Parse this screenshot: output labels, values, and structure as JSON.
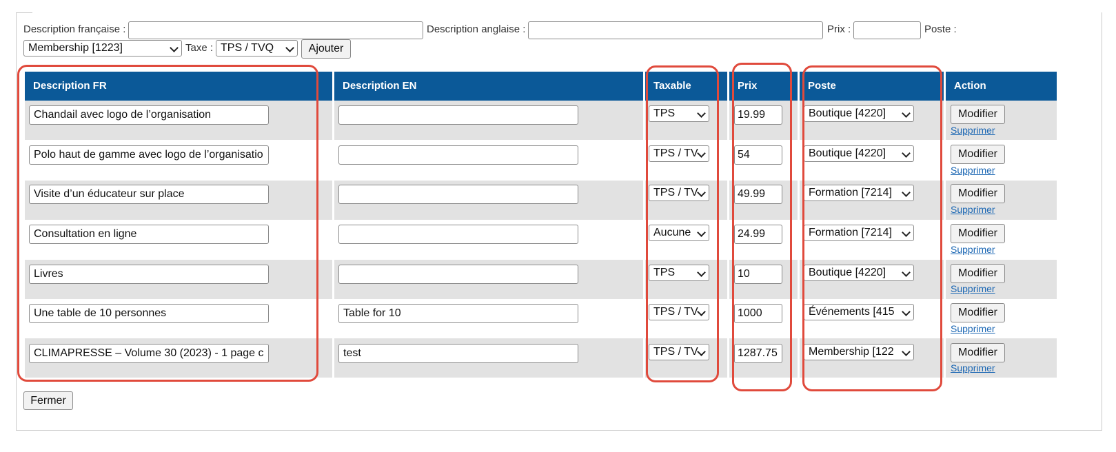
{
  "form": {
    "desc_fr_label": "Description française :",
    "desc_en_label": "Description anglaise :",
    "prix_label": "Prix :",
    "poste_label": "Poste :",
    "poste_selected": "Membership [1223]",
    "taxe_label": "Taxe :",
    "taxe_selected": "TPS / TVQ",
    "add_label": "Ajouter"
  },
  "table": {
    "headers": {
      "desc_fr": "Description FR",
      "desc_en": "Description EN",
      "taxable": "Taxable",
      "prix": "Prix",
      "poste": "Poste",
      "action": "Action"
    },
    "rows": [
      {
        "desc_fr": "Chandail avec logo de l’organisation",
        "desc_en": "",
        "taxable": "TPS",
        "prix": "19.99",
        "poste": "Boutique [4220]",
        "modify": "Modifier",
        "delete": "Supprimer"
      },
      {
        "desc_fr": "Polo haut de gamme avec logo de l’organisatio",
        "desc_en": "",
        "taxable": "TPS / TV",
        "prix": "54",
        "poste": "Boutique [4220]",
        "modify": "Modifier",
        "delete": "Supprimer"
      },
      {
        "desc_fr": "Visite d’un éducateur sur place",
        "desc_en": "",
        "taxable": "TPS / TV",
        "prix": "49.99",
        "poste": "Formation [7214]",
        "modify": "Modifier",
        "delete": "Supprimer"
      },
      {
        "desc_fr": "Consultation en ligne",
        "desc_en": "",
        "taxable": "Aucune",
        "prix": "24.99",
        "poste": "Formation [7214]",
        "modify": "Modifier",
        "delete": "Supprimer"
      },
      {
        "desc_fr": "Livres",
        "desc_en": "",
        "taxable": "TPS",
        "prix": "10",
        "poste": "Boutique [4220]",
        "modify": "Modifier",
        "delete": "Supprimer"
      },
      {
        "desc_fr": "Une table de 10 personnes",
        "desc_en": "Table for 10",
        "taxable": "TPS / TV",
        "prix": "1000",
        "poste": "Événements [415",
        "modify": "Modifier",
        "delete": "Supprimer"
      },
      {
        "desc_fr": "CLIMAPRESSE – Volume 30 (2023) - 1 page c",
        "desc_en": "test",
        "taxable": "TPS / TV",
        "prix": "1287.75",
        "poste": "Membership [122",
        "modify": "Modifier",
        "delete": "Supprimer"
      }
    ]
  },
  "footer": {
    "close_label": "Fermer"
  },
  "colors": {
    "header_bg": "#0b5998",
    "row_alt_bg": "#e2e2e2",
    "highlight": "#e04a3c",
    "link": "#1a66b3"
  }
}
